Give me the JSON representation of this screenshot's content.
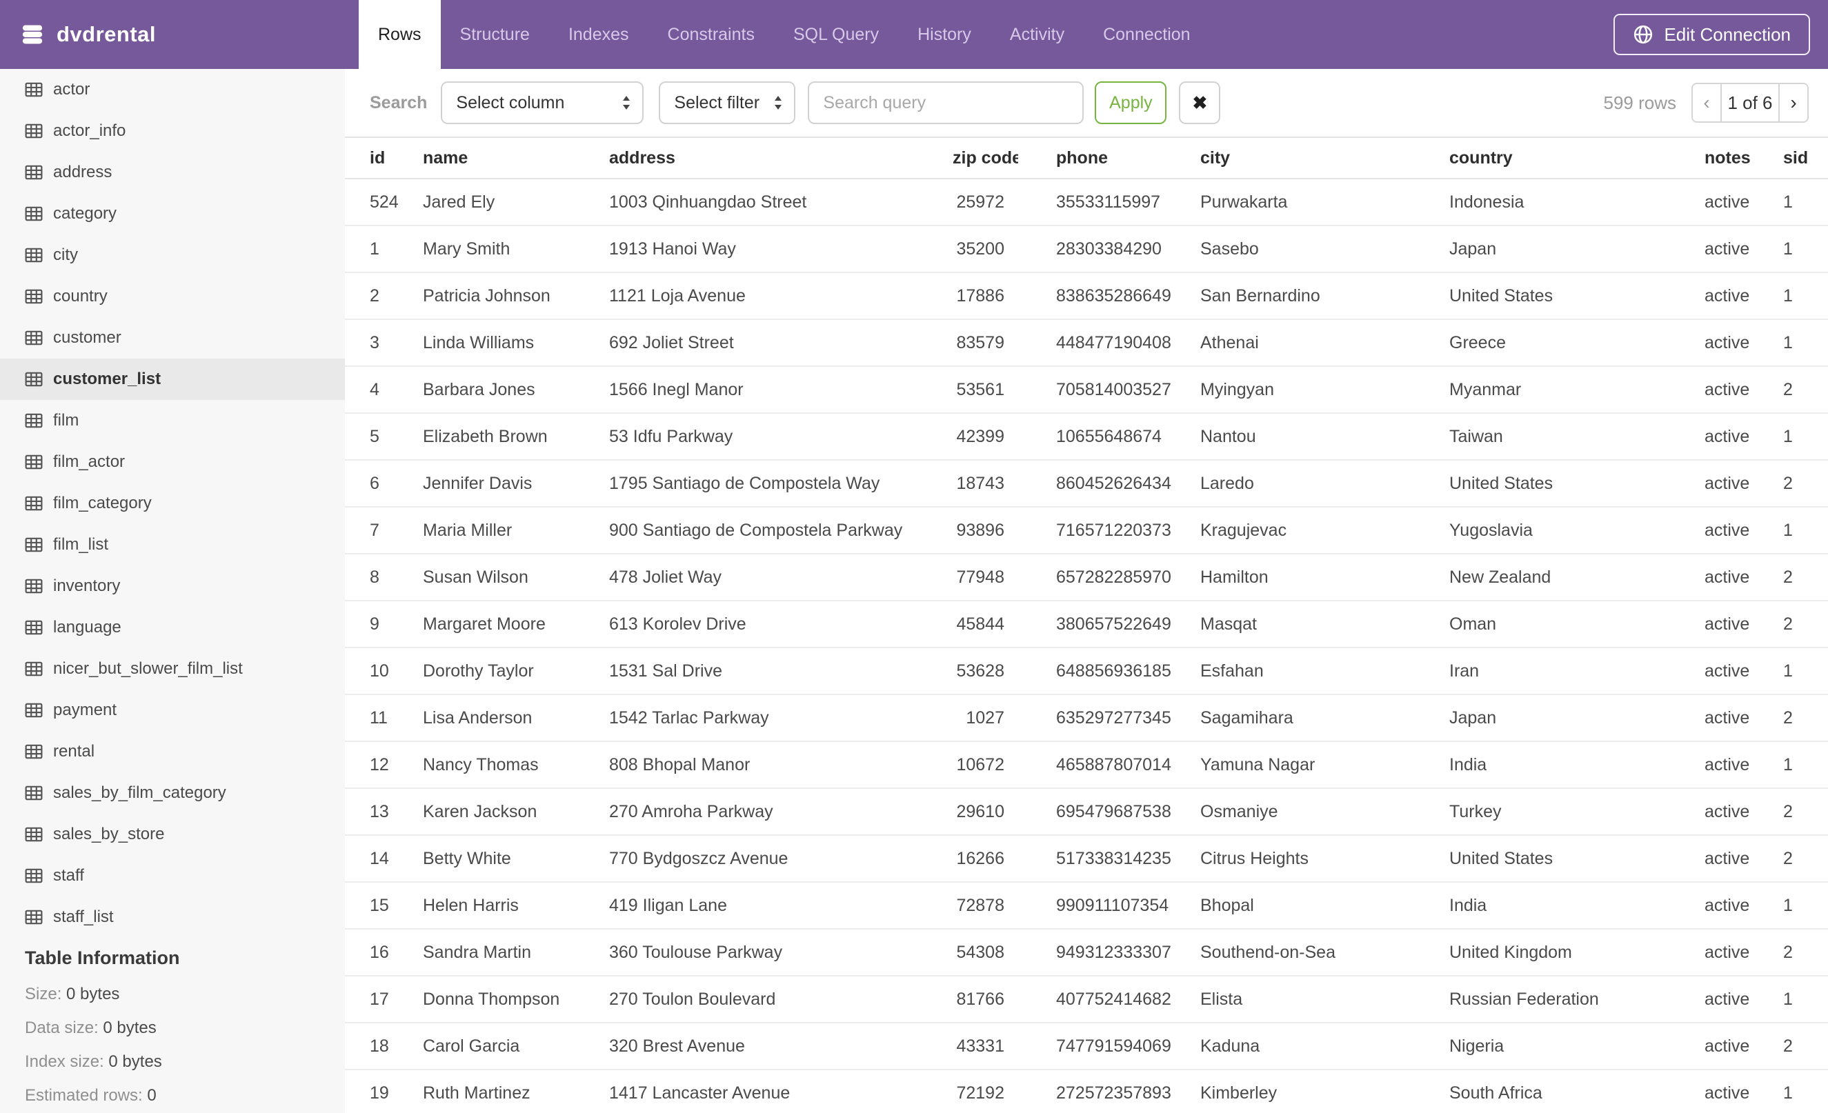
{
  "app": {
    "title": "dvdrental"
  },
  "header": {
    "tabs": [
      {
        "label": "Rows",
        "active": true
      },
      {
        "label": "Structure",
        "active": false
      },
      {
        "label": "Indexes",
        "active": false
      },
      {
        "label": "Constraints",
        "active": false
      },
      {
        "label": "SQL Query",
        "active": false
      },
      {
        "label": "History",
        "active": false
      },
      {
        "label": "Activity",
        "active": false
      },
      {
        "label": "Connection",
        "active": false
      }
    ],
    "edit_connection_label": "Edit Connection"
  },
  "toolbar": {
    "search_label": "Search",
    "column_select_value": "Select column",
    "filter_select_value": "Select filter",
    "query_placeholder": "Search query",
    "query_value": "",
    "apply_label": "Apply",
    "clear_glyph": "✖",
    "row_count": "599 rows",
    "pagination": {
      "prev_glyph": "‹",
      "current": "1 of 6",
      "next_glyph": "›"
    }
  },
  "sidebar": {
    "tables": [
      "actor",
      "actor_info",
      "address",
      "category",
      "city",
      "country",
      "customer",
      "customer_list",
      "film",
      "film_actor",
      "film_category",
      "film_list",
      "inventory",
      "language",
      "nicer_but_slower_film_list",
      "payment",
      "rental",
      "sales_by_film_category",
      "sales_by_store",
      "staff",
      "staff_list"
    ],
    "selected_table": "customer_list",
    "info": {
      "title": "Table Information",
      "items": [
        {
          "label": "Size:",
          "value": "0 bytes"
        },
        {
          "label": "Data size:",
          "value": "0 bytes"
        },
        {
          "label": "Index size:",
          "value": "0 bytes"
        },
        {
          "label": "Estimated rows:",
          "value": "0"
        }
      ]
    }
  },
  "table": {
    "columns": [
      "id",
      "name",
      "address",
      "zip code",
      "phone",
      "city",
      "country",
      "notes",
      "sid"
    ],
    "rows": [
      [
        "524",
        "Jared Ely",
        "1003 Qinhuangdao Street",
        "25972",
        "35533115997",
        "Purwakarta",
        "Indonesia",
        "active",
        "1"
      ],
      [
        "1",
        "Mary Smith",
        "1913 Hanoi Way",
        "35200",
        "28303384290",
        "Sasebo",
        "Japan",
        "active",
        "1"
      ],
      [
        "2",
        "Patricia Johnson",
        "1121 Loja Avenue",
        "17886",
        "838635286649",
        "San Bernardino",
        "United States",
        "active",
        "1"
      ],
      [
        "3",
        "Linda Williams",
        "692 Joliet Street",
        "83579",
        "448477190408",
        "Athenai",
        "Greece",
        "active",
        "1"
      ],
      [
        "4",
        "Barbara Jones",
        "1566 Inegl Manor",
        "53561",
        "705814003527",
        "Myingyan",
        "Myanmar",
        "active",
        "2"
      ],
      [
        "5",
        "Elizabeth Brown",
        "53 Idfu Parkway",
        "42399",
        "10655648674",
        "Nantou",
        "Taiwan",
        "active",
        "1"
      ],
      [
        "6",
        "Jennifer Davis",
        "1795 Santiago de Compostela Way",
        "18743",
        "860452626434",
        "Laredo",
        "United States",
        "active",
        "2"
      ],
      [
        "7",
        "Maria Miller",
        "900 Santiago de Compostela Parkway",
        "93896",
        "716571220373",
        "Kragujevac",
        "Yugoslavia",
        "active",
        "1"
      ],
      [
        "8",
        "Susan Wilson",
        "478 Joliet Way",
        "77948",
        "657282285970",
        "Hamilton",
        "New Zealand",
        "active",
        "2"
      ],
      [
        "9",
        "Margaret Moore",
        "613 Korolev Drive",
        "45844",
        "380657522649",
        "Masqat",
        "Oman",
        "active",
        "2"
      ],
      [
        "10",
        "Dorothy Taylor",
        "1531 Sal Drive",
        "53628",
        "648856936185",
        "Esfahan",
        "Iran",
        "active",
        "1"
      ],
      [
        "11",
        "Lisa Anderson",
        "1542 Tarlac Parkway",
        "1027",
        "635297277345",
        "Sagamihara",
        "Japan",
        "active",
        "2"
      ],
      [
        "12",
        "Nancy Thomas",
        "808 Bhopal Manor",
        "10672",
        "465887807014",
        "Yamuna Nagar",
        "India",
        "active",
        "1"
      ],
      [
        "13",
        "Karen Jackson",
        "270 Amroha Parkway",
        "29610",
        "695479687538",
        "Osmaniye",
        "Turkey",
        "active",
        "2"
      ],
      [
        "14",
        "Betty White",
        "770 Bydgoszcz Avenue",
        "16266",
        "517338314235",
        "Citrus Heights",
        "United States",
        "active",
        "2"
      ],
      [
        "15",
        "Helen Harris",
        "419 Iligan Lane",
        "72878",
        "990911107354",
        "Bhopal",
        "India",
        "active",
        "1"
      ],
      [
        "16",
        "Sandra Martin",
        "360 Toulouse Parkway",
        "54308",
        "949312333307",
        "Southend-on-Sea",
        "United Kingdom",
        "active",
        "2"
      ],
      [
        "17",
        "Donna Thompson",
        "270 Toulon Boulevard",
        "81766",
        "407752414682",
        "Elista",
        "Russian Federation",
        "active",
        "1"
      ],
      [
        "18",
        "Carol Garcia",
        "320 Brest Avenue",
        "43331",
        "747791594069",
        "Kaduna",
        "Nigeria",
        "active",
        "2"
      ],
      [
        "19",
        "Ruth Martinez",
        "1417 Lancaster Avenue",
        "72192",
        "272572357893",
        "Kimberley",
        "South Africa",
        "active",
        "1"
      ]
    ]
  },
  "colors": {
    "header_purple": "#75599b",
    "apply_green": "#77b540",
    "selected_table_bg": "#e9e9e9",
    "muted_text": "#9b9b9b"
  }
}
